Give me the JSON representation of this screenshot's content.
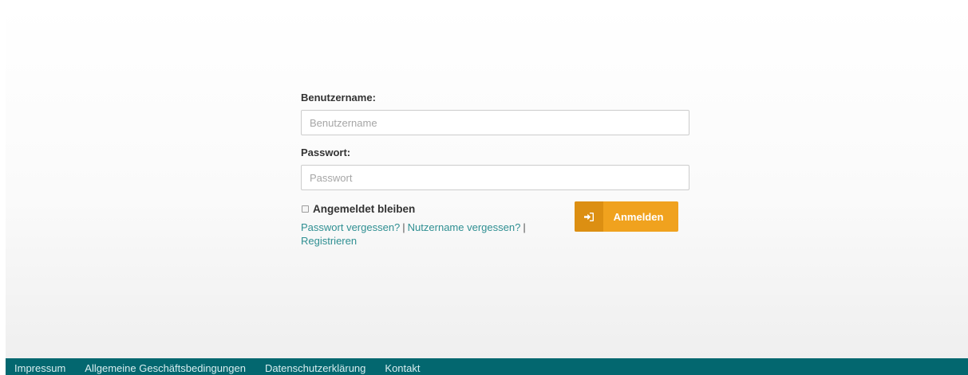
{
  "login": {
    "username_label": "Benutzername:",
    "username_placeholder": "Benutzername",
    "username_value": "",
    "password_label": "Passwort:",
    "password_placeholder": "Passwort",
    "password_value": "",
    "remember_label": "Angemeldet bleiben",
    "remember_checked": false,
    "forgot_password": "Passwort vergessen?",
    "forgot_username": "Nutzername vergessen?",
    "register": "Registrieren",
    "separator": "|",
    "submit_label": "Anmelden",
    "submit_icon": "sign-in-icon"
  },
  "footer": {
    "links": [
      "Impressum",
      "Allgemeine Geschäftsbedingungen",
      "Datenschutzerklärung",
      "Kontakt"
    ]
  },
  "colors": {
    "accent": "#f0a21e",
    "accent_dark": "#dc8f12",
    "link": "#2f8f92",
    "footer_bg": "#03676f"
  }
}
